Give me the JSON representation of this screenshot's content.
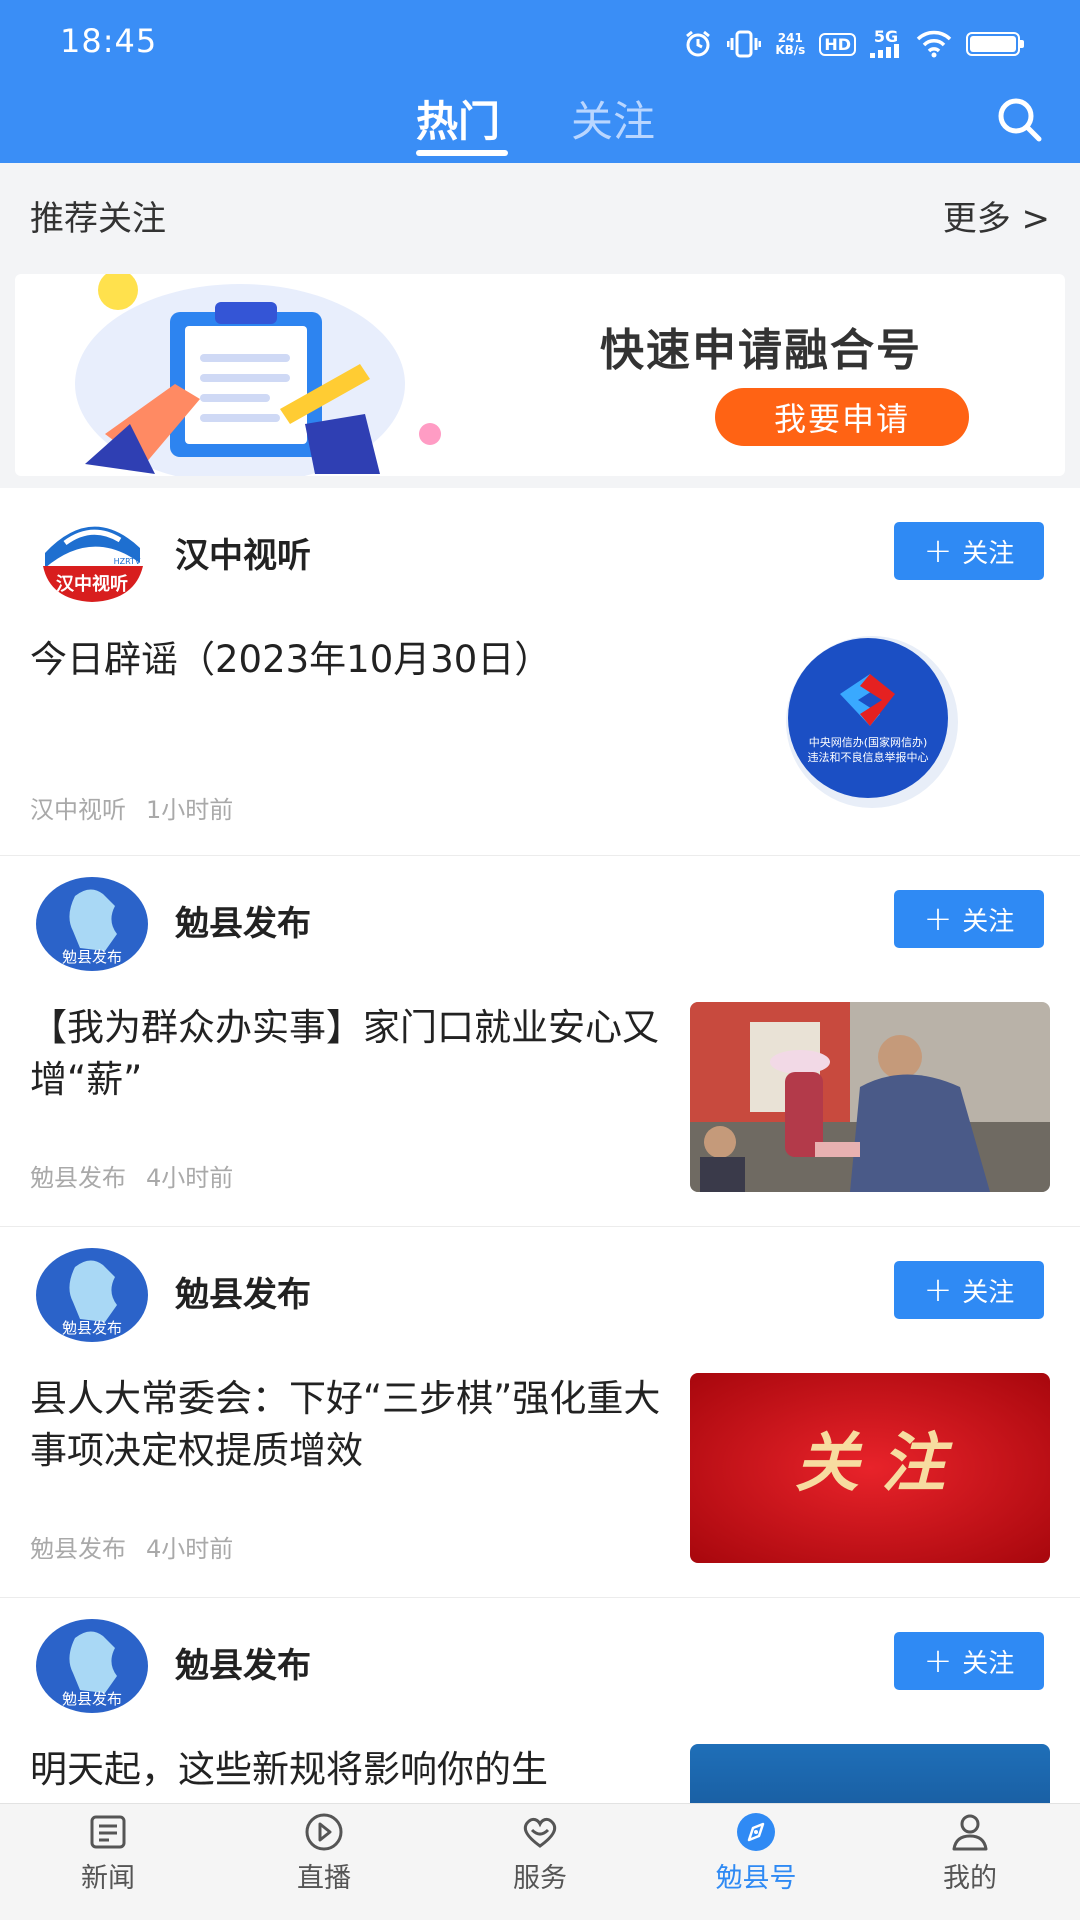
{
  "status_bar": {
    "time": "18:45",
    "net_speed_value": "241",
    "net_speed_unit": "KB/s",
    "hd": "HD",
    "signal": "5G"
  },
  "header": {
    "tabs": [
      {
        "label": "热门",
        "active": true
      },
      {
        "label": "关注",
        "active": false
      }
    ],
    "search_icon": "search-icon"
  },
  "recommend": {
    "title": "推荐关注",
    "more": "更多 >"
  },
  "banner": {
    "title": "快速申请融合号",
    "button": "我要申请"
  },
  "feed": [
    {
      "account": "汉中视听",
      "follow_label": "关注",
      "headline": "今日辟谣（2023年10月30日）",
      "source": "汉中视听",
      "time": "1小时前",
      "avatar_text": "汉中视听",
      "avatar_sub": "HZRTV",
      "thumb_text": "中央网信办(国家网信办)\n违法和不良信息举报中心"
    },
    {
      "account": "勉县发布",
      "follow_label": "关注",
      "headline": "【我为群众办实事】家门口就业安心又增“薪”",
      "source": "勉县发布",
      "time": "4小时前",
      "avatar_text": "勉县发布"
    },
    {
      "account": "勉县发布",
      "follow_label": "关注",
      "headline": "县人大常委会：下好“三步棋”强化重大事项决定权提质增效",
      "source": "勉县发布",
      "time": "4小时前",
      "avatar_text": "勉县发布",
      "thumb_text": "关 注"
    },
    {
      "account": "勉县发布",
      "follow_label": "关注",
      "headline": "明天起，这些新规将影响你的生",
      "avatar_text": "勉县发布"
    }
  ],
  "bottom_nav": [
    {
      "label": "新闻",
      "icon": "news-icon",
      "active": false
    },
    {
      "label": "直播",
      "icon": "live-play-icon",
      "active": false
    },
    {
      "label": "服务",
      "icon": "service-heart-icon",
      "active": false
    },
    {
      "label": "勉县号",
      "icon": "compass-icon",
      "active": true
    },
    {
      "label": "我的",
      "icon": "profile-icon",
      "active": false
    }
  ],
  "colors": {
    "header_blue": "#3a8ef6",
    "follow_blue": "#2f8af4",
    "apply_orange": "#ff6314",
    "meta_gray": "#a9a9a9"
  }
}
